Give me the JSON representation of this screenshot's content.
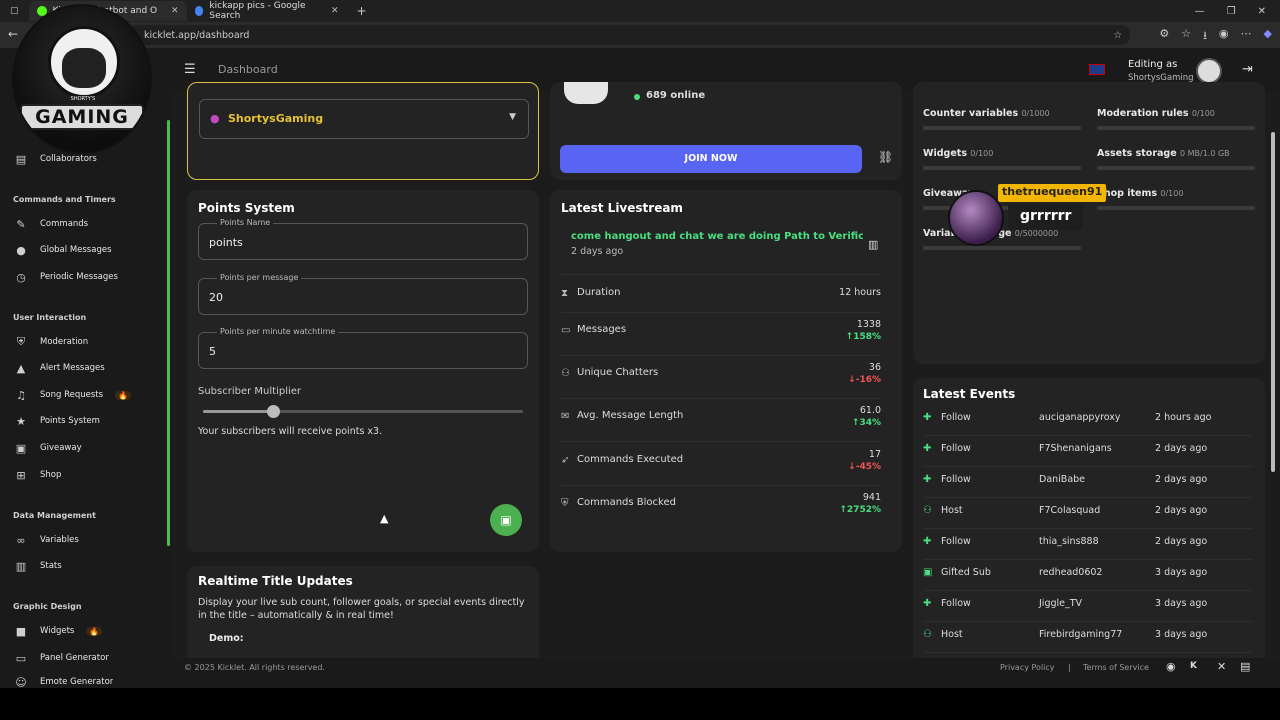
{
  "browser": {
    "tabs": [
      {
        "label": "Kicklet - Chatbot and O",
        "active": true
      },
      {
        "label": "kickapp pics - Google Search",
        "active": false
      }
    ],
    "url": "kicklet.app/dashboard"
  },
  "logo": {
    "text": "GAMING",
    "sub": "SHORTY'S"
  },
  "topbar": {
    "breadcrumb": "Dashboard",
    "editing_label": "Editing as",
    "editing_user": "ShortysGaming"
  },
  "sidebar": {
    "items_top": [
      {
        "label": "Collaborators",
        "icon": "clipboard-icon"
      }
    ],
    "sections": [
      {
        "title": "Commands and Timers",
        "items": [
          {
            "label": "Commands",
            "icon": "wrench-icon"
          },
          {
            "label": "Global Messages",
            "icon": "chat-icon"
          },
          {
            "label": "Periodic Messages",
            "icon": "clock-icon"
          }
        ]
      },
      {
        "title": "User Interaction",
        "items": [
          {
            "label": "Moderation",
            "icon": "shield-icon"
          },
          {
            "label": "Alert Messages",
            "icon": "warning-icon"
          },
          {
            "label": "Song Requests",
            "icon": "music-icon",
            "badge": "🔥"
          },
          {
            "label": "Points System",
            "icon": "star-icon"
          },
          {
            "label": "Giveaway",
            "icon": "gift-icon"
          },
          {
            "label": "Shop",
            "icon": "cart-icon"
          }
        ]
      },
      {
        "title": "Data Management",
        "items": [
          {
            "label": "Variables",
            "icon": "link-icon"
          },
          {
            "label": "Stats",
            "icon": "bar-chart-icon"
          }
        ]
      },
      {
        "title": "Graphic Design",
        "items": [
          {
            "label": "Widgets",
            "icon": "video-icon",
            "badge": "🔥"
          },
          {
            "label": "Panel Generator",
            "icon": "panel-icon"
          },
          {
            "label": "Emote Generator",
            "icon": "emote-icon"
          }
        ]
      }
    ]
  },
  "channel_card": {
    "selected_channel": "ShortysGaming"
  },
  "discord_card": {
    "online": "689 online",
    "join_label": "JOIN NOW"
  },
  "points": {
    "title": "Points System",
    "name_label": "Points Name",
    "name_value": "points",
    "per_message_label": "Points per message",
    "per_message_value": "20",
    "per_minute_label": "Points per minute watchtime",
    "per_minute_value": "5",
    "multiplier_label": "Subscriber Multiplier",
    "multiplier_level": 0.22,
    "multiplier_note": "Your subscribers will receive points x3."
  },
  "livestream": {
    "title": "Latest Livestream",
    "stream_title": "come hangout and chat we are doing Path to Verific",
    "ago": "2 days ago",
    "stats": [
      {
        "label": "Duration",
        "value": "12 hours",
        "delta": "",
        "dir": ""
      },
      {
        "label": "Messages",
        "value": "1338",
        "delta": "158%",
        "dir": "up"
      },
      {
        "label": "Unique Chatters",
        "value": "36",
        "delta": "-16%",
        "dir": "down"
      },
      {
        "label": "Avg. Message Length",
        "value": "61.0",
        "delta": "34%",
        "dir": "up"
      },
      {
        "label": "Commands Executed",
        "value": "17",
        "delta": "-45%",
        "dir": "down"
      },
      {
        "label": "Commands Blocked",
        "value": "941",
        "delta": "2752%",
        "dir": "up"
      }
    ]
  },
  "realtime": {
    "title": "Realtime Title Updates",
    "desc": "Display your live sub count, follower goals, or special events directly in the title – automatically & in real time!",
    "demo": "Demo:"
  },
  "limits": [
    {
      "label": "Counter variables",
      "value": "0/1000"
    },
    {
      "label": "Moderation rules",
      "value": "0/100"
    },
    {
      "label": "Widgets",
      "value": "0/100"
    },
    {
      "label": "Assets storage",
      "value": "0 MB/1.0 GB"
    },
    {
      "label": "Giveaways",
      "value": ""
    },
    {
      "label": "Shop items",
      "value": "0/100"
    },
    {
      "label": "Variable storage",
      "value": "0/5000000"
    }
  ],
  "events": {
    "title": "Latest Events",
    "rows": [
      {
        "type": "Follow",
        "user": "auciganappyroxy",
        "when": "2 hours ago"
      },
      {
        "type": "Follow",
        "user": "F7Shenanigans",
        "when": "2 days ago"
      },
      {
        "type": "Follow",
        "user": "DaniBabe",
        "when": "2 days ago"
      },
      {
        "type": "Host",
        "user": "F7Colasquad",
        "when": "2 days ago"
      },
      {
        "type": "Follow",
        "user": "thia_sins888",
        "when": "2 days ago"
      },
      {
        "type": "Gifted Sub",
        "user": "redhead0602",
        "when": "3 days ago"
      },
      {
        "type": "Follow",
        "user": "Jiggle_TV",
        "when": "3 days ago"
      },
      {
        "type": "Host",
        "user": "Firebirdgaming77",
        "when": "3 days ago"
      }
    ]
  },
  "overlay": {
    "username": "thetruequeen91",
    "message": "grrrrrr"
  },
  "footer": {
    "copyright": "© 2025 Kicklet. All rights reserved.",
    "privacy": "Privacy Policy",
    "sep": "|",
    "terms": "Terms of Service"
  }
}
